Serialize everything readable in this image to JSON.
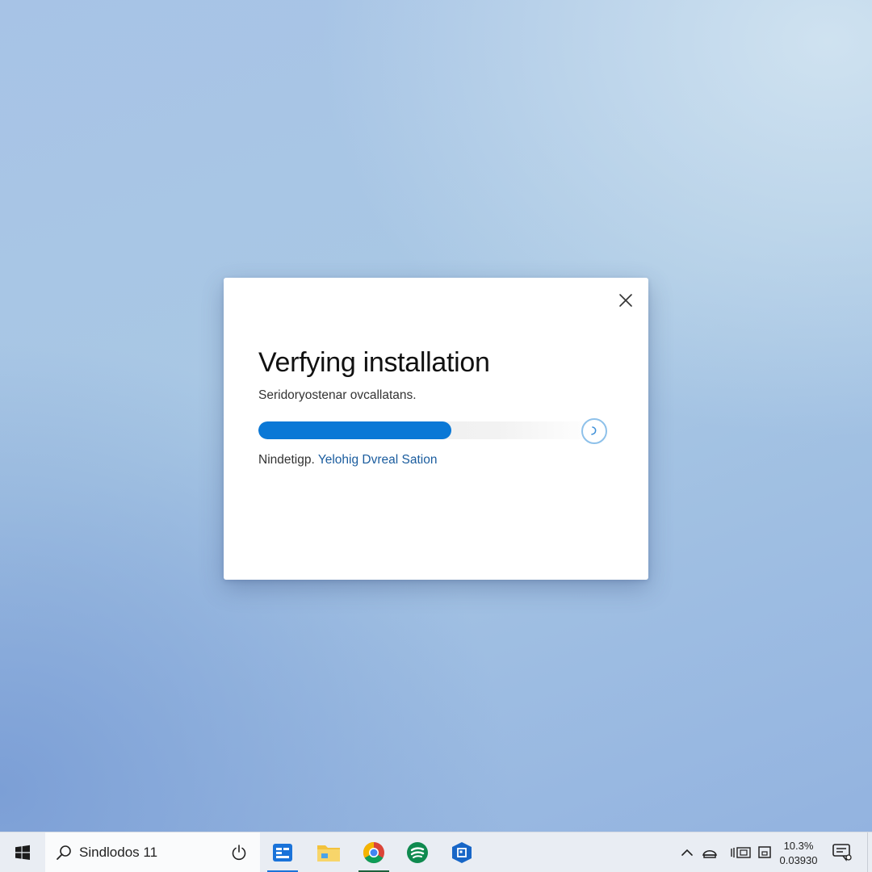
{
  "dialog": {
    "title": "Verfying installation",
    "subtitle": "Seridoryostenar ovcallatans.",
    "progress_percent": 57,
    "status_prefix": "Nindetigp.",
    "status_link": "Yelohig Dvreal Sation",
    "close_icon": "close-icon"
  },
  "taskbar": {
    "search_text": "Sindlodos 11",
    "apps": [
      {
        "name": "widgets-app",
        "color": "#1a73d9"
      },
      {
        "name": "file-explorer-app",
        "color": "#f3c23c"
      },
      {
        "name": "chrome-app",
        "color": "#34a853"
      },
      {
        "name": "green-app",
        "color": "#0f8a4f"
      },
      {
        "name": "store-app",
        "color": "#1766c7"
      }
    ],
    "clock_line1": "10.3%",
    "clock_line2": "0.03930"
  },
  "colors": {
    "accent": "#0a78d6",
    "link": "#1a5c9e"
  }
}
